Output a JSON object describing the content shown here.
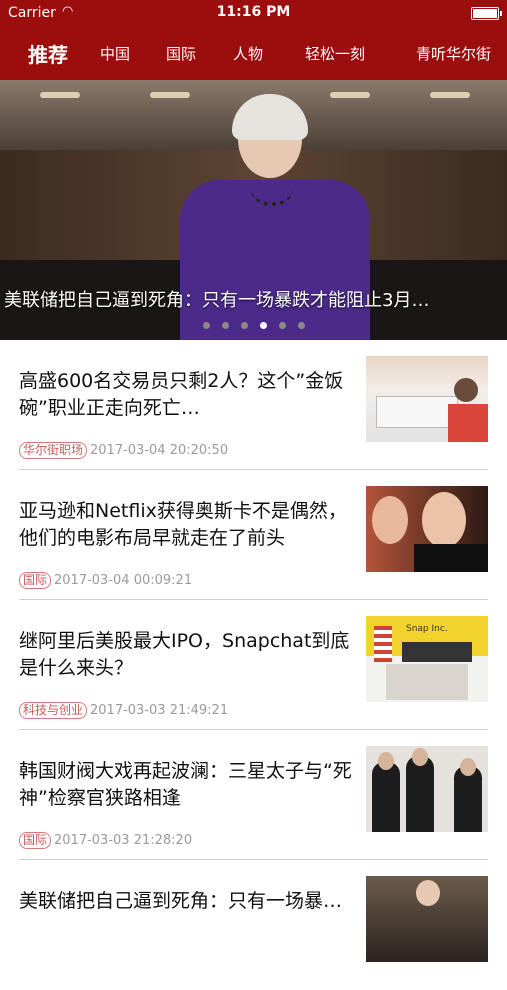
{
  "status": {
    "carrier": "Carrier",
    "wifi_icon": "wifi-icon",
    "time": "11:16 PM",
    "battery_level": 1.0
  },
  "tabs": [
    {
      "label": "推荐",
      "active": true
    },
    {
      "label": "中国"
    },
    {
      "label": "国际"
    },
    {
      "label": "人物"
    },
    {
      "label": "轻松一刻"
    },
    {
      "label": "青听华尔街"
    }
  ],
  "hero": {
    "caption": "美联储把自己逼到死角：只有一场暴跌才能阻止3月…",
    "dots": 6,
    "active_dot": 4
  },
  "articles": [
    {
      "title": "高盛600名交易员只剩2人？这个”金饭碗”职业正走向死亡…",
      "tag": "华尔街职场",
      "date": "2017-03-04 20:20:50"
    },
    {
      "title": "亚马逊和Netflix获得奥斯卡不是偶然，他们的电影布局早就走在了前头",
      "tag": "国际",
      "date": "2017-03-04 00:09:21"
    },
    {
      "title": "继阿里后美股最大IPO，Snapchat到底是什么来头？",
      "tag": "科技与创业",
      "date": "2017-03-03 21:49:21",
      "thumb_text": "Snap Inc."
    },
    {
      "title": "韩国财阀大戏再起波澜：三星太子与“死神”检察官狭路相逢",
      "tag": "国际",
      "date": "2017-03-03 21:28:20"
    },
    {
      "title": "美联储把自己逼到死角：只有一场暴…"
    }
  ]
}
